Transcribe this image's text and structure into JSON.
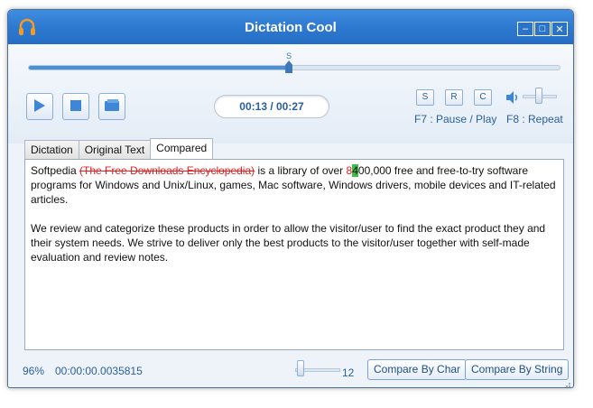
{
  "window": {
    "title": "Dictation Cool",
    "minimize": "–",
    "maximize": "□",
    "close": "✕"
  },
  "player": {
    "seek_progress": 0.49,
    "seek_mark": "S",
    "time": "00:13 / 00:27",
    "source_buttons": [
      "S",
      "R",
      "C"
    ],
    "hint_pause": "F7 : Pause / Play",
    "hint_repeat": "F8 : Repeat",
    "volume_level": 0.55
  },
  "tabs": [
    "Dictation",
    "Original Text",
    "Compared"
  ],
  "active_tab": "Compared",
  "compared": {
    "p1_a": "Softpedia ",
    "p1_deleted": "(The Free Downloads Encyclopedia)",
    "p1_b": " is a library of over ",
    "p1_changed": "8",
    "p1_inserted": "4",
    "p1_c": "00,000 free and free-to-try software programs for Windows and Unix/Linux, games, Mac software, Windows drivers, mobile devices and IT-related articles.",
    "p2": "We review and categorize these products in order to allow the visitor/user to find the exact product they and their system needs. We strive to deliver only the best products to the visitor/user together with self-made evaluation and review notes."
  },
  "status": {
    "percent": "96%",
    "elapsed": "00:00:00.0035815",
    "slider_value": "12",
    "compare_char": "Compare By Char",
    "compare_string": "Compare By String"
  },
  "colors": {
    "accent": "#2f7bd2",
    "deleted": "#e02020",
    "inserted": "#3fbf4a"
  }
}
